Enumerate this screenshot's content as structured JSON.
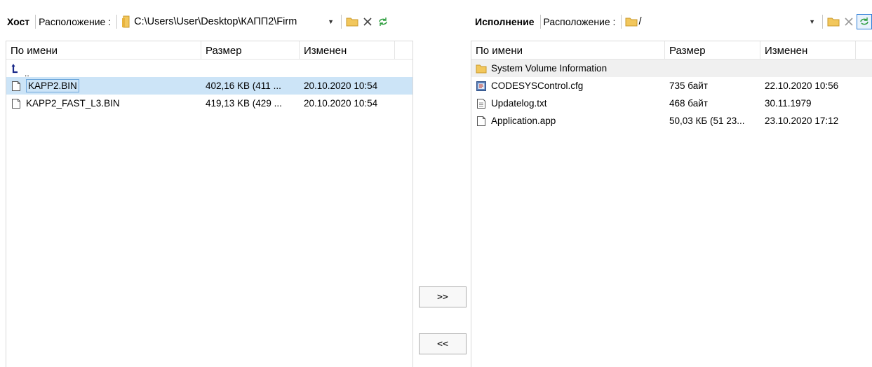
{
  "host_toolbar": {
    "title": "Хост",
    "location_label": "Расположение :",
    "path": "C:\\Users\\User\\Desktop\\КАПП2\\Firm"
  },
  "device_toolbar": {
    "title": "Исполнение",
    "location_label": "Расположение :",
    "path": "/"
  },
  "host_table": {
    "columns": [
      "По имени",
      "Размер",
      "Изменен"
    ],
    "up_label": "..",
    "rows": [
      {
        "name": "KAPP2.BIN",
        "size": "402,16 KB (411 ...",
        "modified": "20.10.2020 10:54",
        "icon": "file-icon",
        "selected": true
      },
      {
        "name": "KAPP2_FAST_L3.BIN",
        "size": "419,13 KB (429 ...",
        "modified": "20.10.2020 10:54",
        "icon": "file-icon",
        "selected": false
      }
    ]
  },
  "device_table": {
    "columns": [
      "По имени",
      "Размер",
      "Изменен"
    ],
    "rows": [
      {
        "name": "System Volume Information",
        "size": "",
        "modified": "",
        "icon": "folder-icon"
      },
      {
        "name": "CODESYSControl.cfg",
        "size": "735 байт",
        "modified": "22.10.2020 10:56",
        "icon": "config-file-icon"
      },
      {
        "name": "Updatelog.txt",
        "size": "468 байт",
        "modified": "30.11.1979",
        "icon": "text-file-icon"
      },
      {
        "name": "Application.app",
        "size": "50,03 КБ (51 23...",
        "modified": "23.10.2020 17:12",
        "icon": "file-icon"
      }
    ]
  },
  "transfer": {
    "to_device_label": ">>",
    "to_host_label": "<<"
  },
  "colors": {
    "selection": "#cce4f7",
    "folder": "#f2c75c",
    "refresh": "#2e9e3f"
  }
}
